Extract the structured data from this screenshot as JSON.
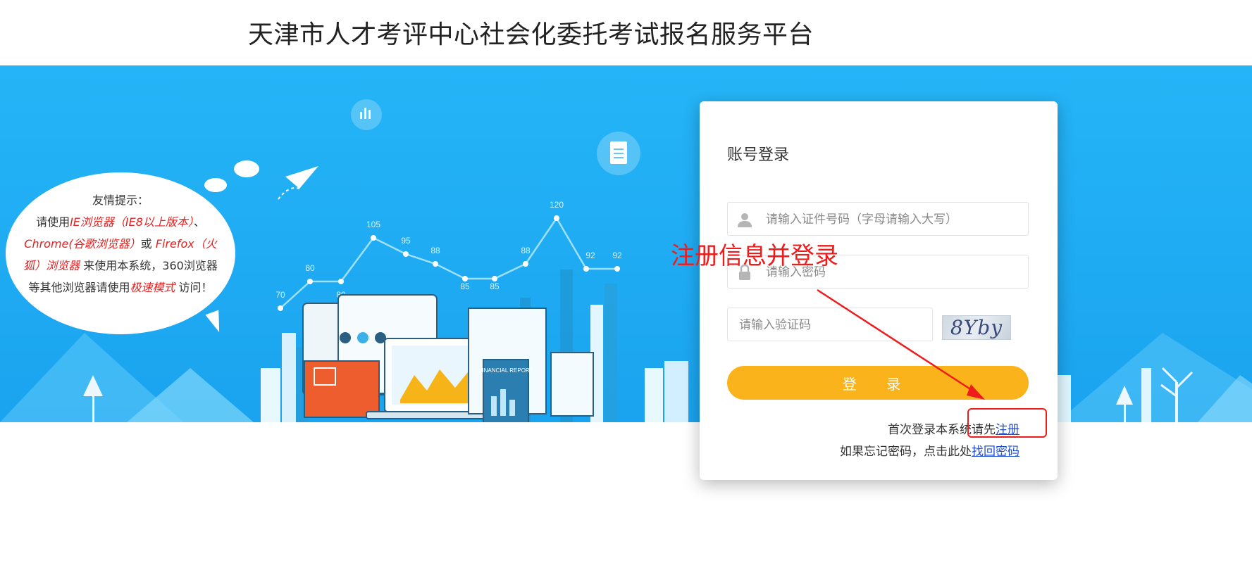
{
  "header": {
    "title": "天津市人才考评中心社会化委托考试报名服务平台"
  },
  "tip": {
    "heading": "友情提示：",
    "line1_pre": "请使用",
    "line1_red": "IE浏览器（IE8以上版本）",
    "line1_post": "、",
    "line2_red": "Chrome(谷歌浏览器）",
    "line2_mid": "或 ",
    "line2_red2": "Firefox（火",
    "line3_red": "狐）浏览器",
    "line3_post": " 来使用本系统，360浏览器",
    "line4_pre": "等其他浏览器请使用",
    "line4_red": "极速模式",
    "line4_post": " 访问！"
  },
  "banner_chart": {
    "values": [
      70,
      80,
      80,
      105,
      95,
      88,
      85,
      85,
      88,
      120,
      92,
      92
    ],
    "report_label": "FINANCIAL REPORT"
  },
  "login": {
    "title": "账号登录",
    "id_placeholder": "请输入证件号码（字母请输入大写）",
    "password_placeholder": "请输入密码",
    "captcha_placeholder": "请输入验证码",
    "captcha_text": "8Yby",
    "submit_label": "登 录",
    "register_prefix": "首次登录本系统请先",
    "register_link": "注册",
    "forgot_prefix": "如果忘记密码，点击此处",
    "forgot_link": "找回密码"
  },
  "annotation": {
    "text": "注册信息并登录",
    "color": "#ef1c1c"
  },
  "colors": {
    "banner": "#1fabf3",
    "button": "#fbb31b",
    "link": "#1f4fd1"
  }
}
